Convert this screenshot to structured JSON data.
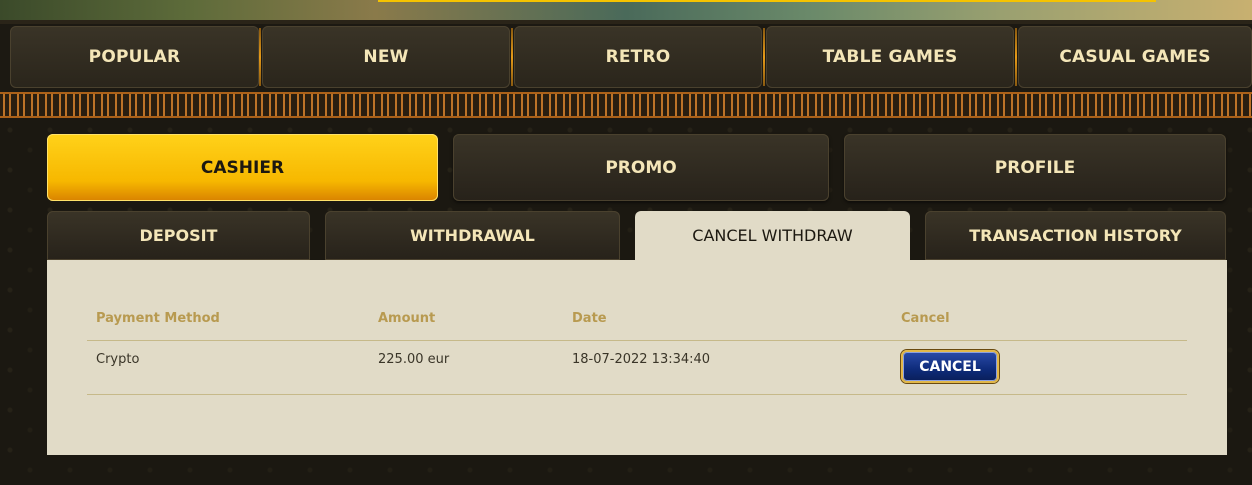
{
  "topnav": {
    "items": [
      {
        "label": "POPULAR"
      },
      {
        "label": "NEW"
      },
      {
        "label": "RETRO"
      },
      {
        "label": "TABLE GAMES"
      },
      {
        "label": "CASUAL GAMES"
      }
    ]
  },
  "account_tabs": {
    "items": [
      {
        "label": "CASHIER",
        "active": true
      },
      {
        "label": "PROMO",
        "active": false
      },
      {
        "label": "PROFILE",
        "active": false
      }
    ]
  },
  "cashier_tabs": {
    "items": [
      {
        "label": "DEPOSIT",
        "active": false
      },
      {
        "label": "WITHDRAWAL",
        "active": false
      },
      {
        "label": "CANCEL WITHDRAW",
        "active": true
      },
      {
        "label": "TRANSACTION HISTORY",
        "active": false
      }
    ]
  },
  "table": {
    "headers": {
      "payment_method": "Payment Method",
      "amount": "Amount",
      "date": "Date",
      "cancel": "Cancel"
    },
    "rows": [
      {
        "payment_method": "Crypto",
        "amount": "225.00 eur",
        "date": "18-07-2022 13:34:40",
        "cancel_label": "CANCEL"
      }
    ]
  },
  "colors": {
    "accent_gold": "#f7b800",
    "header_text": "#b89a50",
    "button_blue": "#0e2b7a"
  }
}
